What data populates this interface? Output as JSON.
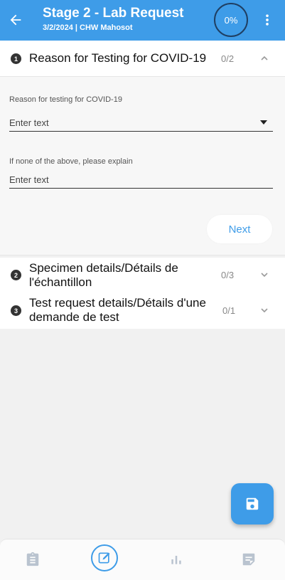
{
  "header": {
    "title": "Stage 2 - Lab Request",
    "subtitle": "3/2/2024 | CHW Mahosot",
    "progress": "0%",
    "back_icon": "arrow-left-icon",
    "more_icon": "more-vertical-icon"
  },
  "sections": [
    {
      "number": "1",
      "title": "Reason for Testing for COVID-19",
      "count": "0/2",
      "expanded": true
    },
    {
      "number": "2",
      "title": "Specimen details/Détails de l'échantillon",
      "count": "0/3",
      "expanded": false
    },
    {
      "number": "3",
      "title": "Test request details/Détails d'une demande de test",
      "count": "0/1",
      "expanded": false
    }
  ],
  "form": {
    "reason_label": "Reason for testing for COVID-19",
    "reason_placeholder": "Enter text",
    "explain_label": "If none of the above, please explain",
    "explain_placeholder": "Enter text",
    "next_label": "Next"
  },
  "fab": {
    "icon": "save-icon"
  },
  "bottom_nav": [
    {
      "name": "clipboard-icon",
      "active": false
    },
    {
      "name": "edit-icon",
      "active": true
    },
    {
      "name": "bar-chart-icon",
      "active": false
    },
    {
      "name": "note-icon",
      "active": false
    }
  ],
  "colors": {
    "primary": "#3e9ce8",
    "ring_border": "#1f3f63",
    "nav_icon": "#b9c3cf"
  }
}
